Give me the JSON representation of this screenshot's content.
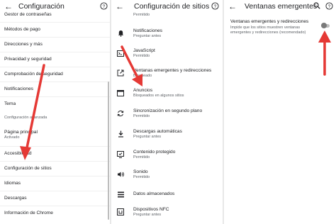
{
  "panel1": {
    "title": "Configuración",
    "items": [
      {
        "label": "Gestor de contraseñas"
      },
      {
        "label": "Métodos de pago"
      },
      {
        "label": "Direcciones y más"
      },
      {
        "label": "Privacidad y seguridad"
      },
      {
        "label": "Comprobación de seguridad"
      },
      {
        "label": "Notificaciones"
      },
      {
        "label": "Tema"
      },
      {
        "label": "Configuración avanzada"
      },
      {
        "label": "Página principal",
        "sub": "Activado"
      },
      {
        "label": "Accesibilidad"
      },
      {
        "label": "Configuración de sitios"
      },
      {
        "label": "Idiomas"
      },
      {
        "label": "Descargas"
      },
      {
        "label": "Información de Chrome"
      }
    ]
  },
  "panel2": {
    "title": "Configuración de sitios",
    "items": [
      {
        "label": "",
        "sub": "Permitido",
        "icon": "partial-icon"
      },
      {
        "label": "Notificaciones",
        "sub": "Preguntar antes",
        "icon": "bell-icon"
      },
      {
        "label": "JavaScript",
        "sub": "Permitido",
        "icon": "javascript-icon"
      },
      {
        "label": "Ventanas emergentes y redirecciones",
        "sub": "Bloqueado",
        "icon": "popup-icon"
      },
      {
        "label": "Anuncios",
        "sub": "Bloqueados en algunos sitios",
        "icon": "ads-icon"
      },
      {
        "label": "Sincronización en segundo plano",
        "sub": "Permitido",
        "icon": "sync-icon"
      },
      {
        "label": "Descargas automáticas",
        "sub": "Preguntar antes",
        "icon": "download-icon"
      },
      {
        "label": "Contenido protegido",
        "sub": "Permitido",
        "icon": "protected-content-icon"
      },
      {
        "label": "Sonido",
        "sub": "Permitido",
        "icon": "sound-icon"
      },
      {
        "label": "Datos almacenados",
        "sub": "",
        "icon": "storage-icon"
      },
      {
        "label": "Dispositivos NFC",
        "sub": "Preguntar antes",
        "icon": "nfc-icon"
      }
    ]
  },
  "panel3": {
    "title": "Ventanas emergentes y redirecciones",
    "setting_label": "Ventanas emergentes y redirecciones",
    "setting_desc": "Impide que los sitios muestren ventanas emergentes y redirecciones (recomendado)",
    "toggle_on": false
  },
  "colors": {
    "arrow": "#e53935",
    "text": "#202124",
    "subtext": "#5f6368",
    "toggle_off": "#7a7a7a"
  }
}
